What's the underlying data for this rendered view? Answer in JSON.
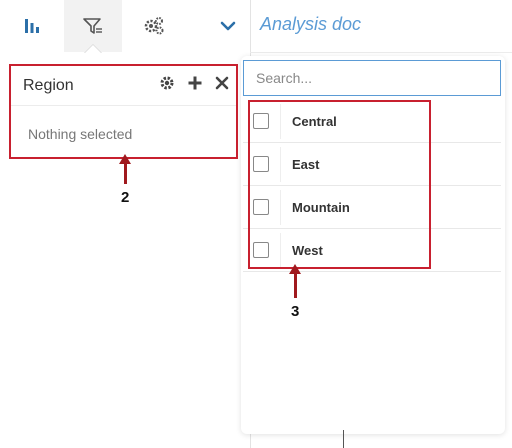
{
  "toolbar": {
    "tabs": [
      {
        "name": "visualization",
        "icon": "bar-chart-icon"
      },
      {
        "name": "filters",
        "icon": "filter-icon",
        "active": true
      },
      {
        "name": "settings",
        "icon": "gears-icon"
      },
      {
        "name": "collapse",
        "icon": "chevron-down-icon"
      }
    ]
  },
  "document": {
    "title": "Analysis doc"
  },
  "region_filter": {
    "title": "Region",
    "status": "Nothing selected",
    "icons": [
      "gear-icon",
      "plus-icon",
      "close-icon"
    ]
  },
  "dropdown": {
    "search_placeholder": "Search...",
    "items": [
      {
        "label": "Central",
        "checked": false
      },
      {
        "label": "East",
        "checked": false
      },
      {
        "label": "Mountain",
        "checked": false
      },
      {
        "label": "West",
        "checked": false
      }
    ]
  },
  "annotations": {
    "label_2": "2",
    "label_3": "3",
    "color": "#c8202f"
  },
  "colors": {
    "accent": "#5b9bd5",
    "icon": "#444444",
    "chevron": "#2b6fa8"
  }
}
